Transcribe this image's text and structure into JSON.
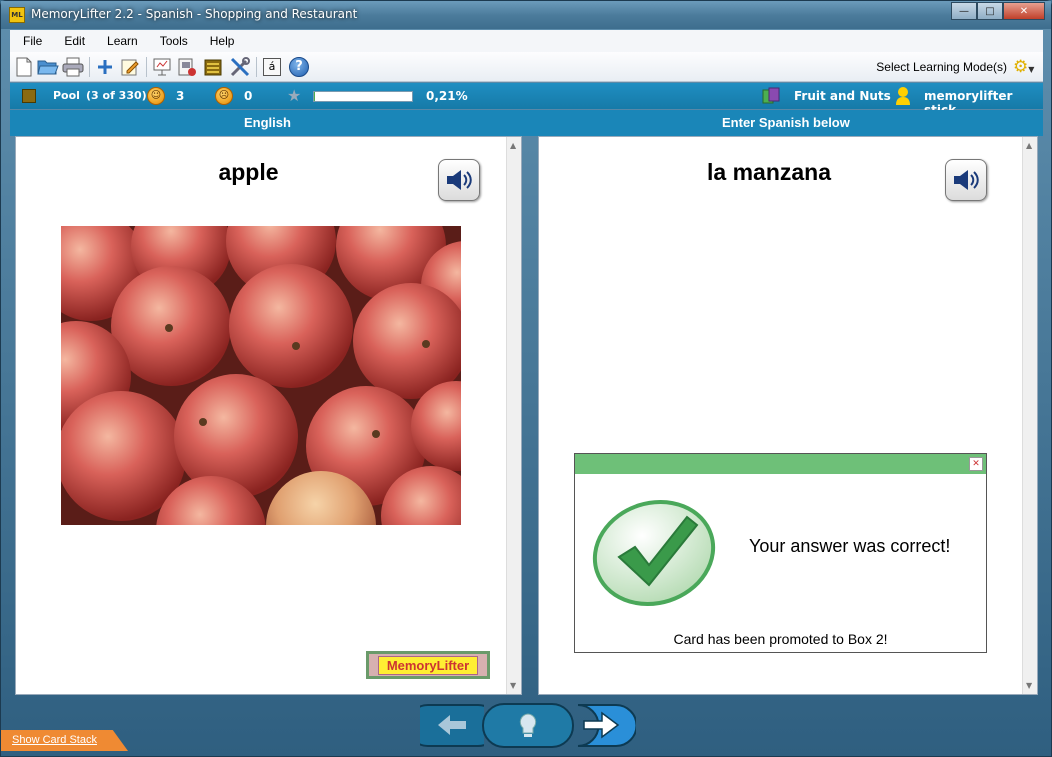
{
  "window": {
    "title": "MemoryLifter 2.2 - Spanish - Shopping and Restaurant",
    "app_icon": "ML"
  },
  "menu": [
    "File",
    "Edit",
    "Learn",
    "Tools",
    "Help"
  ],
  "toolbar": {
    "icons": [
      "new-icon",
      "open-icon",
      "print-icon",
      "add-card-icon",
      "edit-card-icon",
      "slideshow-icon",
      "card-stack-icon",
      "box-icon",
      "tools-icon",
      "accent-char-icon",
      "help-icon"
    ],
    "accent_char": "á",
    "help_char": "?",
    "mode_label": "Select Learning Mode(s)"
  },
  "status": {
    "pool_label": "Pool",
    "pool_count": "(3 of 330)",
    "correct_count": "3",
    "wrong_count": "0",
    "progress_percent_text": "0,21%",
    "progress_fraction": 0.0021,
    "chapter": "Fruit and Nuts",
    "user": "memorylifter stick"
  },
  "headings": {
    "question": "English",
    "answer": "Enter Spanish below"
  },
  "question": {
    "word": "apple"
  },
  "answer": {
    "word": "la manzana"
  },
  "logo": "MemoryLifter",
  "result": {
    "message": "Your answer was correct!",
    "sub": "Card has been promoted to Box 2!"
  },
  "bottom": {
    "show_card_stack": "Show Card Stack"
  },
  "colors": {
    "accent": "#1a86b8",
    "result_bar": "#6ec078",
    "check": "#3a9a4a"
  }
}
